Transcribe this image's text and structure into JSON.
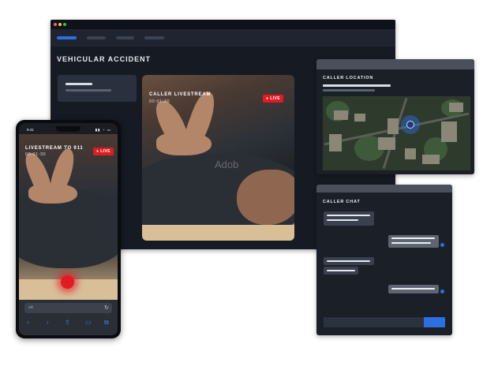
{
  "desktop": {
    "page_title": "VEHICULAR ACCIDENT"
  },
  "main_stream": {
    "label": "CALLER LIVESTREAM",
    "time": "00:01:30",
    "badge": "LIVE",
    "watermark": "Adob"
  },
  "location_panel": {
    "title": "CALLER LOCATION"
  },
  "chat_panel": {
    "title": "CALLER CHAT"
  },
  "phone": {
    "status_time": "9:41",
    "status_icons": "▮▮ ◔ ▭",
    "stream_label": "LIVESTREAM TO 911",
    "stream_time": "00:01:30",
    "badge": "LIVE",
    "url_text": "aA",
    "reload_icon": "↻",
    "toolbar_icons": [
      "‹",
      "›",
      "⇪",
      "▭",
      "⧉"
    ]
  },
  "colors": {
    "accent": "#2d6fe0",
    "live": "#e21b23",
    "panel": "#1b1f28",
    "window": "#161a22"
  }
}
